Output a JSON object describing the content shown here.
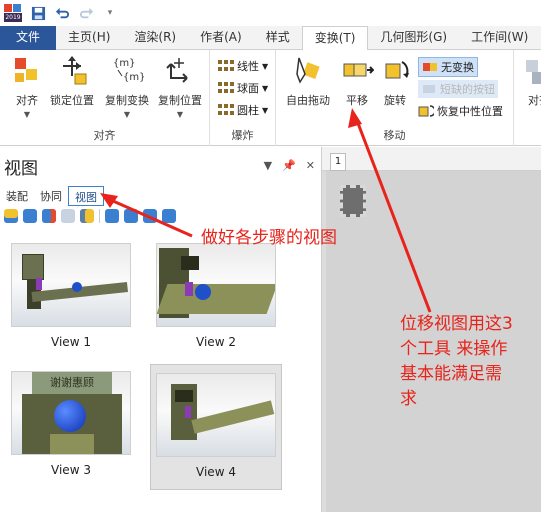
{
  "quick_access": {
    "app_badge": "2019"
  },
  "ribbon_tabs": [
    "文件",
    "主页(H)",
    "渲染(R)",
    "作者(A)",
    "样式",
    "变换(T)",
    "几何图形(G)",
    "工作间(W)"
  ],
  "active_tab_index": 5,
  "ribbon": {
    "align_group": {
      "label": "对齐",
      "buttons": [
        "对齐",
        "锁定位置",
        "复制变换",
        "复制位置"
      ]
    },
    "explode_group": {
      "label": "爆炸",
      "buttons": [
        "线性",
        "球面",
        "圆柱"
      ]
    },
    "move_group": {
      "label": "移动",
      "buttons": [
        "自由拖动",
        "平移",
        "旋转"
      ],
      "side_buttons": [
        "无变换",
        "短缺的按钮",
        "恢复中性位置"
      ]
    },
    "overflow_label": "对齐"
  },
  "panel": {
    "title": "视图",
    "tabs": [
      "装配",
      "协同",
      "视图"
    ],
    "active_tab_index": 2,
    "views": [
      {
        "caption": "View 1"
      },
      {
        "caption": "View 2"
      },
      {
        "caption": "View 3",
        "sign_text": "谢谢惠顾"
      },
      {
        "caption": "View 4"
      }
    ],
    "selected_view_index": 3
  },
  "document": {
    "tab_label": "1"
  },
  "annotations": {
    "note1": "做好各步骤的视图",
    "note2_lines": [
      "位移视图用这3",
      "个工具 来操作",
      "基本能满足需",
      "求"
    ]
  },
  "colors": {
    "file_tab": "#2b579a",
    "annotation": "#e8231b",
    "selection": "#3e7fce"
  }
}
